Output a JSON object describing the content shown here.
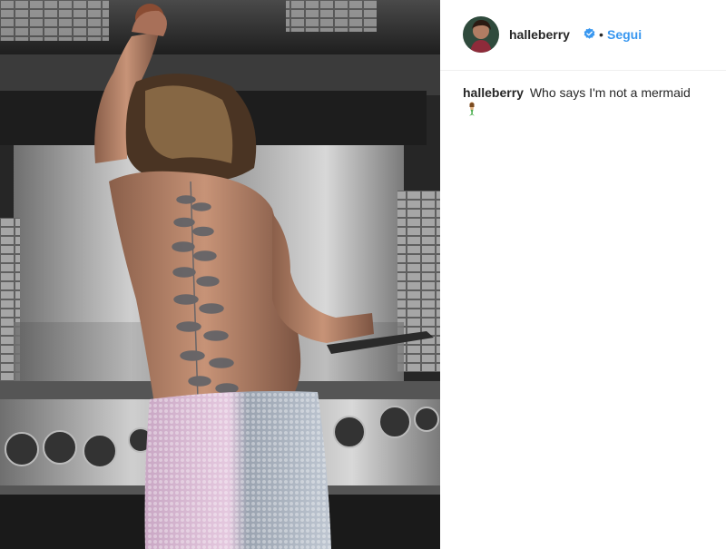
{
  "post": {
    "image_alt": "photo-post",
    "header": {
      "username": "halleberry",
      "separator": "•",
      "follow_label": "Segui",
      "verified_icon": "verified-badge-icon"
    },
    "caption": {
      "username": "halleberry",
      "text": "Who says I'm not a mermaid",
      "emoji_icon": "mermaid-emoji-icon"
    },
    "colors": {
      "follow": "#3897f0",
      "verified": "#3897f0",
      "text": "#262626",
      "divider": "#efefef"
    }
  }
}
